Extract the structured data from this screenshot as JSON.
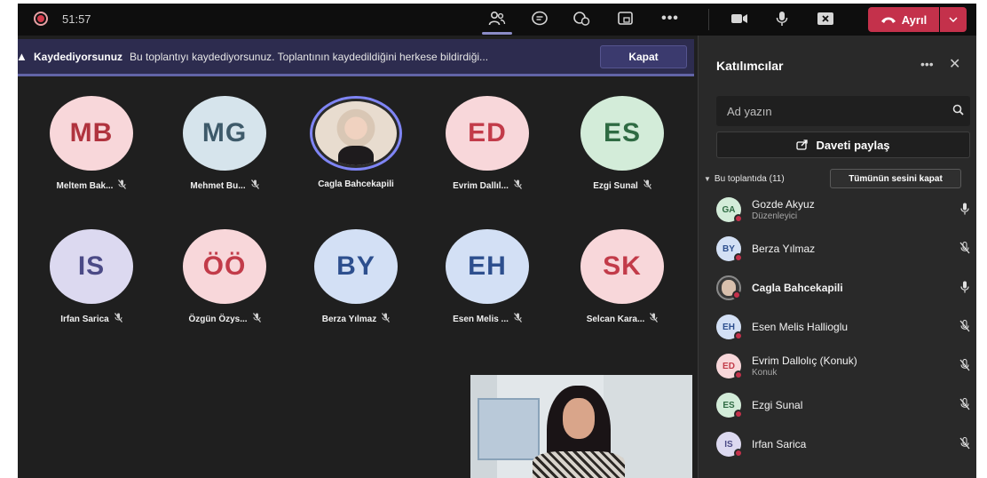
{
  "topbar": {
    "timer": "51:57",
    "leave_label": "Ayrıl",
    "icons": [
      "people-icon",
      "chat-icon",
      "reactions-icon",
      "rooms-icon",
      "more-icon",
      "camera-icon",
      "mic-icon",
      "share-tray-icon"
    ]
  },
  "banner": {
    "title": "Kaydediyorsunuz",
    "message": "Bu toplantıyı kaydediyorsunuz. Toplantının kaydedildiğini herkese bildirdiği...",
    "close_label": "Kapat"
  },
  "grid": [
    {
      "initials": "MB",
      "name": "Meltem Bak...",
      "bg": "#f8d7da",
      "fg": "#b0333e"
    },
    {
      "initials": "MG",
      "name": "Mehmet Bu...",
      "bg": "#d6e4ec",
      "fg": "#3e5a6a"
    },
    {
      "initials": "",
      "name": "Cagla Bahcekapili",
      "bg": "photo",
      "fg": ""
    },
    {
      "initials": "ED",
      "name": "Evrim Dallıl...",
      "bg": "#f8d7da",
      "fg": "#c23b49"
    },
    {
      "initials": "ES",
      "name": "Ezgi Sunal",
      "bg": "#d3ecd9",
      "fg": "#2f6b43"
    },
    {
      "initials": "IS",
      "name": "Irfan Sarica",
      "bg": "#dcd9f0",
      "fg": "#4b4a86"
    },
    {
      "initials": "ÖÖ",
      "name": "Özgün Özys...",
      "bg": "#f8d7da",
      "fg": "#c23b49"
    },
    {
      "initials": "BY",
      "name": "Berza Yılmaz",
      "bg": "#d3e0f5",
      "fg": "#2d4f8e"
    },
    {
      "initials": "EH",
      "name": "Esen Melis ...",
      "bg": "#d3e0f5",
      "fg": "#2d4f8e"
    },
    {
      "initials": "SK",
      "name": "Selcan Kara...",
      "bg": "#f8d7da",
      "fg": "#c23b49"
    }
  ],
  "panel": {
    "title": "Katılımcılar",
    "search_placeholder": "Ad yazın",
    "share_label": "Daveti paylaş",
    "section_label": "Bu toplantıda (11)",
    "mute_all_label": "Tümünün sesini kapat",
    "participants": [
      {
        "initials": "GA",
        "name": "Gozde Akyuz",
        "role": "Düzenleyici",
        "bg": "#d3ecd9",
        "fg": "#2f6b43",
        "mic": "on",
        "photo": false
      },
      {
        "initials": "BY",
        "name": "Berza Yılmaz",
        "role": "",
        "bg": "#d3e0f5",
        "fg": "#2d4f8e",
        "mic": "off",
        "photo": false
      },
      {
        "initials": "",
        "name": "Cagla Bahcekapili",
        "role": "",
        "bg": "",
        "fg": "",
        "mic": "on",
        "photo": true
      },
      {
        "initials": "EH",
        "name": "Esen Melis Hallioglu",
        "role": "",
        "bg": "#d3e0f5",
        "fg": "#2d4f8e",
        "mic": "off",
        "photo": false
      },
      {
        "initials": "ED",
        "name": "Evrim Dallolıç (Konuk)",
        "role": "Konuk",
        "bg": "#f8d7da",
        "fg": "#c23b49",
        "mic": "off",
        "photo": false
      },
      {
        "initials": "ES",
        "name": "Ezgi Sunal",
        "role": "",
        "bg": "#d3ecd9",
        "fg": "#2f6b43",
        "mic": "off",
        "photo": false
      },
      {
        "initials": "IS",
        "name": "Irfan Sarica",
        "role": "",
        "bg": "#dcd9f0",
        "fg": "#4b4a86",
        "mic": "off",
        "photo": false
      }
    ]
  }
}
